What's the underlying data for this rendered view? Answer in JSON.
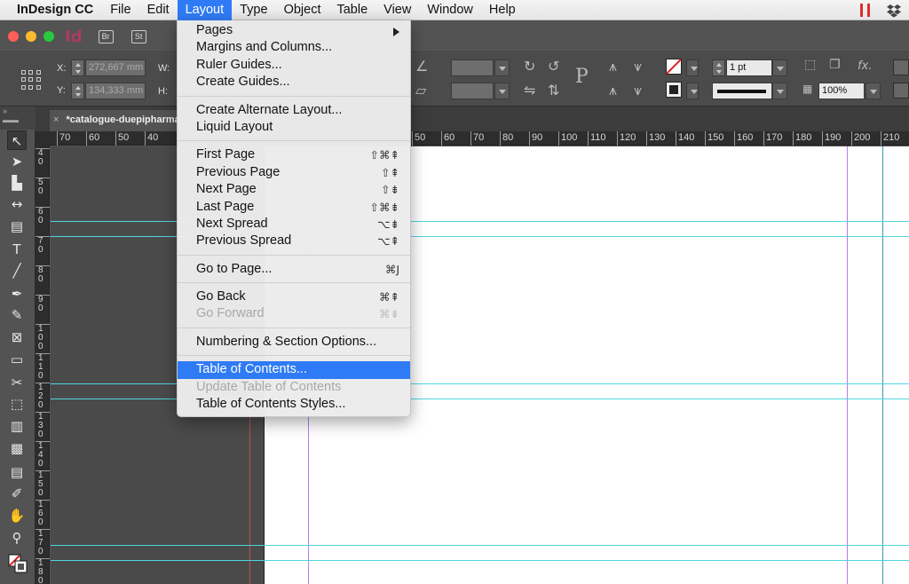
{
  "menubar": {
    "app_name": "InDesign CC",
    "items": [
      "File",
      "Edit",
      "Layout",
      "Type",
      "Object",
      "Table",
      "View",
      "Window",
      "Help"
    ],
    "active_item": "Layout"
  },
  "titlebar": {
    "app_badge": "Id",
    "bridge_badge": "Br",
    "stock_badge": "St"
  },
  "control_panel": {
    "x_label": "X:",
    "x_value": "272,667 mm",
    "y_label": "Y:",
    "y_value": "134,333 mm",
    "w_label": "W:",
    "h_label": "H:",
    "stroke_weight": "1 pt",
    "zoom_value": "100%",
    "fx_label": "fx."
  },
  "document": {
    "tab_title": "*catalogue-duepipharma",
    "tab_close": "×"
  },
  "rulers": {
    "horizontal_left": [
      "70",
      "60",
      "50",
      "40"
    ],
    "horizontal_right": [
      "50",
      "60",
      "70",
      "80",
      "90",
      "100",
      "110",
      "120",
      "130",
      "140",
      "150",
      "160",
      "170",
      "180",
      "190",
      "200",
      "210"
    ],
    "vertical": [
      "4\n0",
      "5\n0",
      "6\n0",
      "7\n0",
      "8\n0",
      "9\n0",
      "1\n0\n0",
      "1\n1\n0",
      "1\n2\n0",
      "1\n3\n0",
      "1\n4\n0",
      "1\n5\n0",
      "1\n6\n0",
      "1\n7\n0",
      "1\n8\n0"
    ]
  },
  "layout_menu": {
    "groups": [
      [
        {
          "label": "Pages",
          "shortcut": "",
          "submenu": true,
          "enabled": true
        },
        {
          "label": "Margins and Columns...",
          "shortcut": "",
          "enabled": true
        },
        {
          "label": "Ruler Guides...",
          "shortcut": "",
          "enabled": true
        },
        {
          "label": "Create Guides...",
          "shortcut": "",
          "enabled": true
        }
      ],
      [
        {
          "label": "Create Alternate Layout...",
          "shortcut": "",
          "enabled": true
        },
        {
          "label": "Liquid Layout",
          "shortcut": "",
          "enabled": true
        }
      ],
      [
        {
          "label": "First Page",
          "shortcut": "⇧⌘⇞",
          "enabled": true
        },
        {
          "label": "Previous Page",
          "shortcut": "⇧⇞",
          "enabled": true
        },
        {
          "label": "Next Page",
          "shortcut": "⇧⇟",
          "enabled": true
        },
        {
          "label": "Last Page",
          "shortcut": "⇧⌘⇟",
          "enabled": true
        },
        {
          "label": "Next Spread",
          "shortcut": "⌥⇟",
          "enabled": true
        },
        {
          "label": "Previous Spread",
          "shortcut": "⌥⇞",
          "enabled": true
        }
      ],
      [
        {
          "label": "Go to Page...",
          "shortcut": "⌘J",
          "enabled": true
        }
      ],
      [
        {
          "label": "Go Back",
          "shortcut": "⌘⇞",
          "enabled": true
        },
        {
          "label": "Go Forward",
          "shortcut": "⌘⇟",
          "enabled": false
        }
      ],
      [
        {
          "label": "Numbering & Section Options...",
          "shortcut": "",
          "enabled": true
        }
      ],
      [
        {
          "label": "Table of Contents...",
          "shortcut": "",
          "enabled": true,
          "highlighted": true
        },
        {
          "label": "Update Table of Contents",
          "shortcut": "",
          "enabled": false
        },
        {
          "label": "Table of Contents Styles...",
          "shortcut": "",
          "enabled": true
        }
      ]
    ]
  },
  "colors": {
    "menu_highlight": "#2f7bf5",
    "guide_cyan": "#4fd6e0",
    "guide_purple": "#b57cf0",
    "guide_teal": "#2f9fa8"
  }
}
